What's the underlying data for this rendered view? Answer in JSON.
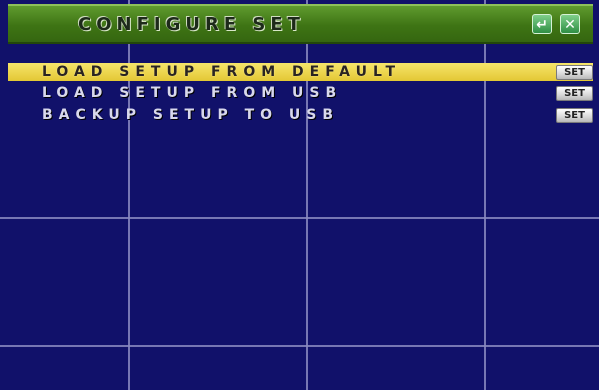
{
  "header": {
    "title": "CONFIGURE SET",
    "enter_icon": "enter-arrow-icon",
    "close_icon": "close-icon"
  },
  "menu": {
    "items": [
      {
        "label": "LOAD SETUP FROM DEFAULT",
        "button_label": "SET",
        "selected": true
      },
      {
        "label": "LOAD SETUP FROM USB",
        "button_label": "SET",
        "selected": false
      },
      {
        "label": "BACKUP SETUP TO USB",
        "button_label": "SET",
        "selected": false
      }
    ]
  },
  "colors": {
    "background": "#11116a",
    "title_bar": "#3e7414",
    "selected_row": "#e3c734",
    "grid": "#8a8ac0"
  }
}
